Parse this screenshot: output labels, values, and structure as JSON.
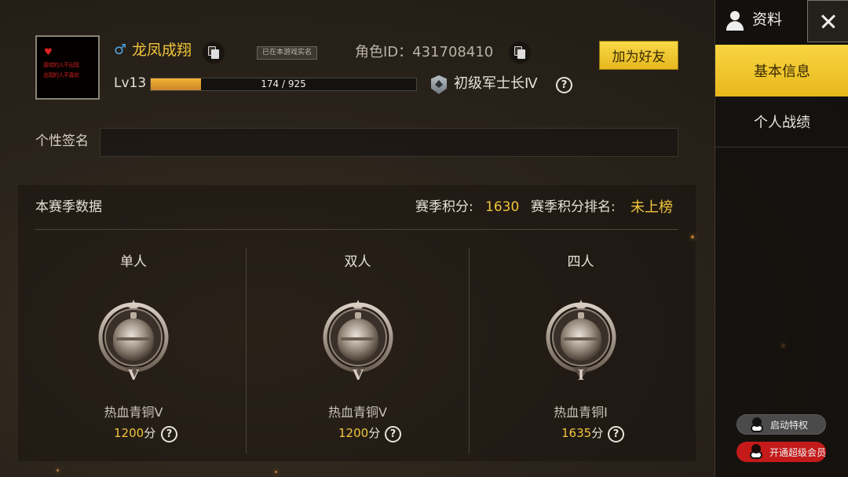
{
  "player": {
    "avatar_text_line1": "喜欢的人不出现",
    "avatar_text_line2": "出现的人不喜欢",
    "gender_symbol": "♂",
    "nickname": "龙凤成翔",
    "realname_tag": "已在本游戏实名",
    "role_id_label": "角色ID：431708410",
    "level_label": "Lv13",
    "xp_text": "174 / 925",
    "xp_fraction": 0.188,
    "rank_title": "初级军士长Ⅳ",
    "add_friend_label": "加为好友",
    "signature_label": "个性签名",
    "signature_value": ""
  },
  "season": {
    "title": "本赛季数据",
    "score_label": "赛季积分:",
    "score_value": "1630",
    "rank_label": "赛季积分排名:",
    "rank_value": "未上榜",
    "modes": [
      {
        "name": "单人",
        "tier": "热血青铜Ⅴ",
        "score": "1200",
        "unit": "分",
        "emblem_numeral": "V"
      },
      {
        "name": "双人",
        "tier": "热血青铜Ⅴ",
        "score": "1200",
        "unit": "分",
        "emblem_numeral": "V"
      },
      {
        "name": "四人",
        "tier": "热血青铜Ⅰ",
        "score": "1635",
        "unit": "分",
        "emblem_numeral": "I"
      }
    ]
  },
  "side": {
    "title": "资料",
    "tabs": [
      {
        "label": "基本信息",
        "active": true
      },
      {
        "label": "个人战绩",
        "active": false
      }
    ],
    "privilege_label": "启动特权",
    "vip_label": "开通超级会员"
  },
  "colors": {
    "accent_yellow": "#f1c53a",
    "tab_active": "#f0c430",
    "vip_red": "#c41a1a",
    "gender_blue": "#4fa3e0"
  }
}
